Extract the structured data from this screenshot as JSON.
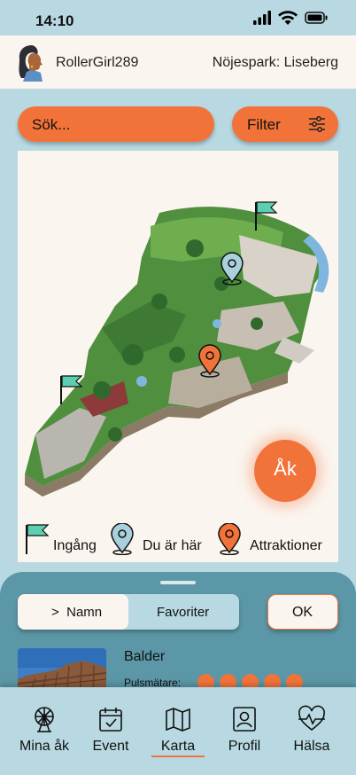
{
  "status": {
    "time": "14:10"
  },
  "header": {
    "username": "RollerGirl289",
    "park": "Nöjespark: Liseberg"
  },
  "search": {
    "placeholder": "Sök..."
  },
  "filter": {
    "label": "Filter"
  },
  "map": {
    "ride_button": "Åk"
  },
  "legend": {
    "entrance": "Ingång",
    "you_are_here": "Du är här",
    "attractions": "Attraktioner"
  },
  "sheet": {
    "tabs": [
      {
        "label": "Namn",
        "prefix": ">"
      },
      {
        "label": "Favoriter"
      }
    ],
    "ok_label": "OK",
    "ride": {
      "name": "Balder",
      "pulse_label": "Pulsmätare:",
      "pulse_level": 5
    }
  },
  "nav": {
    "items": [
      {
        "label": "Mina åk",
        "icon": "ferris-wheel-icon"
      },
      {
        "label": "Event",
        "icon": "calendar-icon"
      },
      {
        "label": "Karta",
        "icon": "map-icon"
      },
      {
        "label": "Profil",
        "icon": "profile-icon"
      },
      {
        "label": "Hälsa",
        "icon": "heart-pulse-icon"
      }
    ],
    "active": "Karta"
  },
  "colors": {
    "accent": "#f2733a",
    "background": "#b8d9e2",
    "sheet": "#5b97a6",
    "header": "#fbf5ef",
    "entrance_flag": "#5ccfb0",
    "you_pin": "#a9d0dd"
  }
}
